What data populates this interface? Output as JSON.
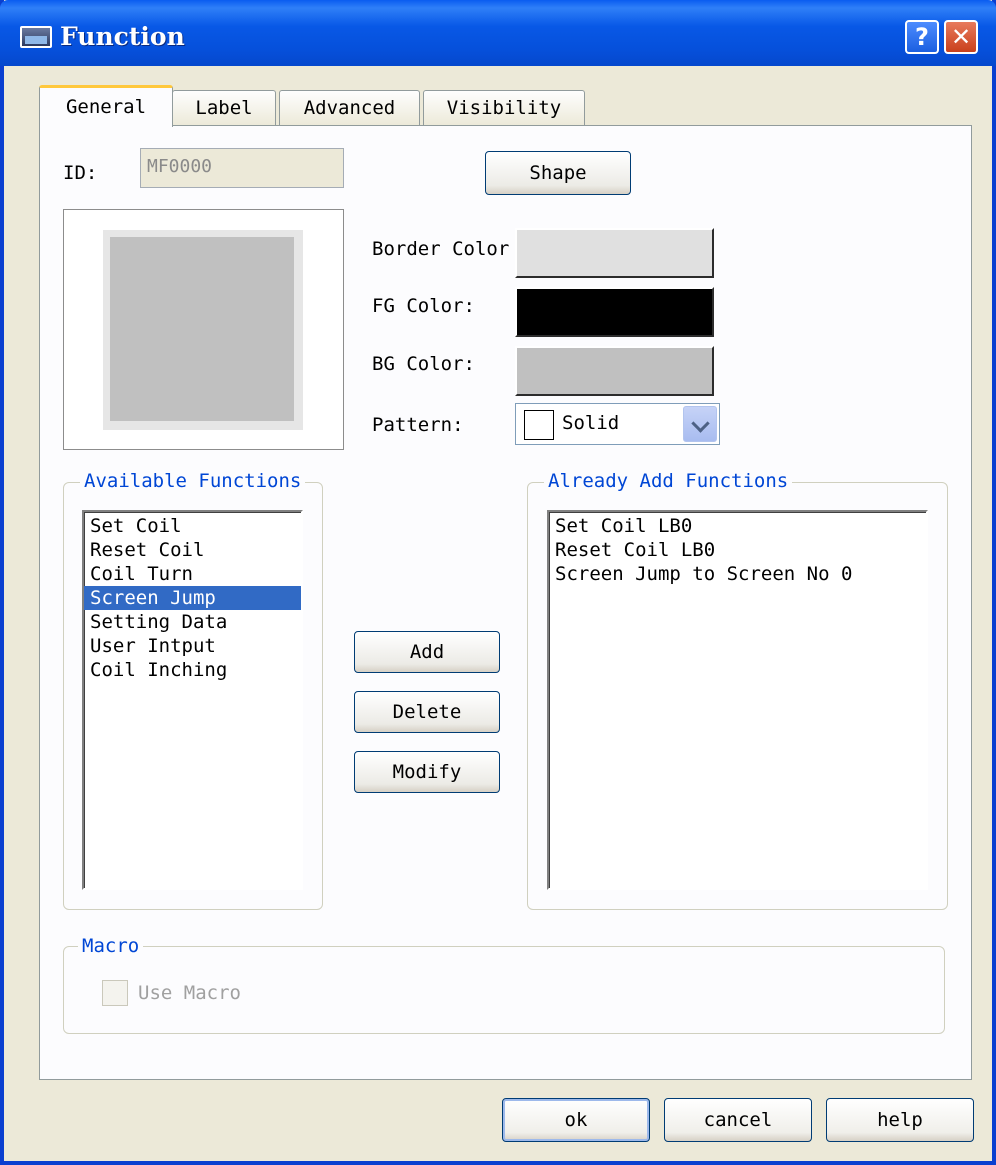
{
  "window": {
    "title": "Function",
    "help_glyph": "?",
    "close_glyph": "✕"
  },
  "tabs": [
    {
      "label": "General",
      "active": true
    },
    {
      "label": "Label",
      "active": false
    },
    {
      "label": "Advanced",
      "active": false
    },
    {
      "label": "Visibility",
      "active": false
    }
  ],
  "general": {
    "id_label": "ID:",
    "id_value": "MF0000",
    "shape_button": "Shape",
    "border_color_label": "Border Color",
    "fg_color_label": "FG Color:",
    "bg_color_label": "BG Color:",
    "pattern_label": "Pattern:",
    "pattern_value": "Solid",
    "colors": {
      "border": "#e0e0e0",
      "fg": "#000000",
      "bg": "#c0c0c0",
      "preview_outer": "#e6e6e6",
      "preview_inner": "#c0c0c0"
    }
  },
  "available": {
    "title": "Available Functions",
    "items": [
      "Set Coil",
      "Reset Coil",
      "Coil Turn",
      "Screen Jump",
      "Setting Data",
      "User Intput",
      "Coil Inching"
    ],
    "selected_index": 3
  },
  "actions": {
    "add": "Add",
    "delete": "Delete",
    "modify": "Modify"
  },
  "added": {
    "title": "Already Add Functions",
    "items": [
      "Set Coil LB0",
      "Reset Coil LB0",
      "Screen Jump to Screen No 0"
    ]
  },
  "macro": {
    "title": "Macro",
    "checkbox_label": "Use Macro",
    "checked": false,
    "enabled": false
  },
  "footer": {
    "ok": "ok",
    "cancel": "cancel",
    "help": "help"
  }
}
